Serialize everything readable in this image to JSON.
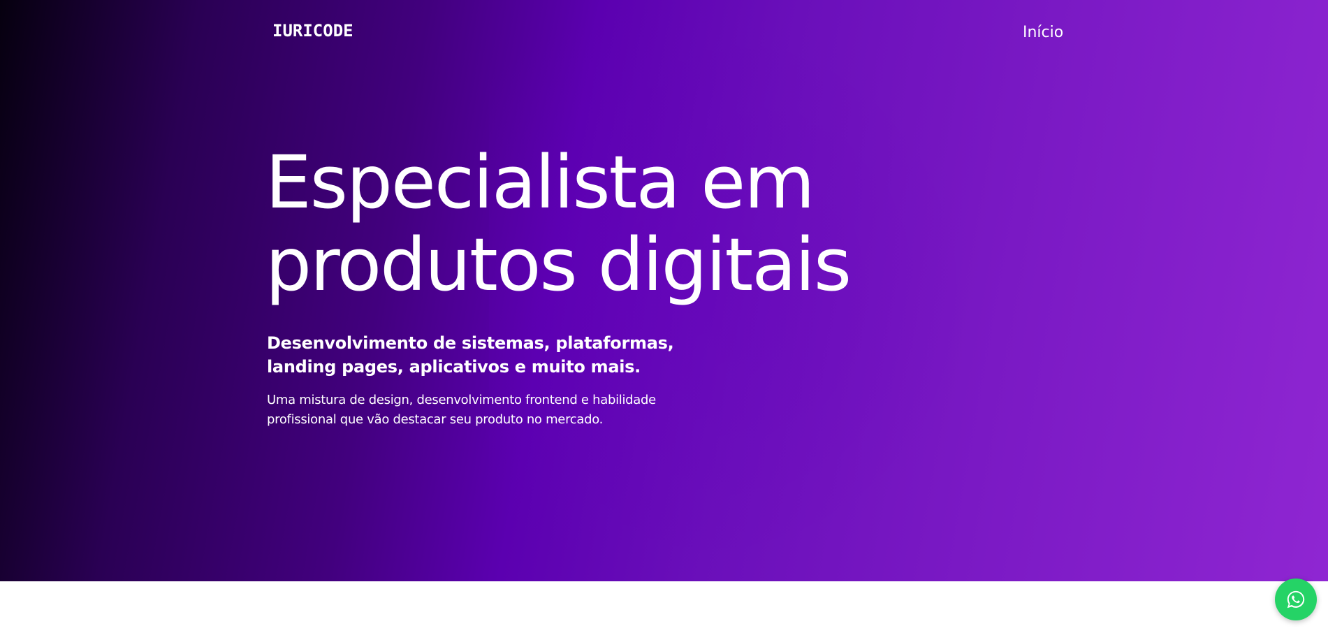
{
  "header": {
    "logo_text": "IURICODE",
    "nav": [
      {
        "label": "Início"
      }
    ]
  },
  "hero": {
    "headline_lines": [
      "Especialista em",
      "produtos digitais"
    ],
    "subtitle_lines": [
      "Desenvolvimento de sistemas, plataformas,",
      "landing pages, aplicativos e muito mais."
    ],
    "description_lines": [
      "Uma mistura de design, desenvolvimento frontend e habilidade",
      "profissional que vão destacar seu produto no mercado."
    ]
  },
  "floating": {
    "whatsapp_icon": "whatsapp-icon",
    "whatsapp_color": "#25d366"
  },
  "colors": {
    "hero_gradient_start": "#06000f",
    "hero_gradient_mid": "#5b00b0",
    "hero_gradient_end": "#8f26d2",
    "text": "#ffffff",
    "page_background": "#ffffff"
  }
}
